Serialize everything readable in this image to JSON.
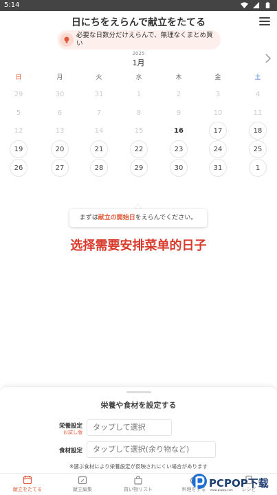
{
  "status": {
    "time": "5:14",
    "icons": [
      "wifi-icon",
      "signal-icon",
      "battery-icon"
    ]
  },
  "header": {
    "title": "日にちをえらんで献立をたてる",
    "menu_icon": "hamburger-menu-icon"
  },
  "tip": {
    "icon": "lightbulb-icon",
    "text": "必要な日数分だけえらんで、無理なくまとめ買い"
  },
  "calendar": {
    "year": "2025",
    "month": "1月",
    "weekdays": [
      "日",
      "月",
      "火",
      "水",
      "木",
      "金",
      "土"
    ],
    "days": [
      {
        "label": "29",
        "state": "disabled"
      },
      {
        "label": "30",
        "state": "disabled"
      },
      {
        "label": "31",
        "state": "disabled"
      },
      {
        "label": "1",
        "state": "disabled"
      },
      {
        "label": "2",
        "state": "disabled"
      },
      {
        "label": "3",
        "state": "disabled"
      },
      {
        "label": "4",
        "state": "disabled"
      },
      {
        "label": "5",
        "state": "disabled"
      },
      {
        "label": "6",
        "state": "disabled"
      },
      {
        "label": "7",
        "state": "disabled"
      },
      {
        "label": "8",
        "state": "disabled"
      },
      {
        "label": "9",
        "state": "disabled"
      },
      {
        "label": "10",
        "state": "disabled"
      },
      {
        "label": "11",
        "state": "disabled"
      },
      {
        "label": "12",
        "state": "disabled"
      },
      {
        "label": "13",
        "state": "disabled"
      },
      {
        "label": "14",
        "state": "disabled"
      },
      {
        "label": "15",
        "state": "disabled"
      },
      {
        "label": "16",
        "state": "today"
      },
      {
        "label": "17",
        "state": "active"
      },
      {
        "label": "18",
        "state": "active"
      },
      {
        "label": "19",
        "state": "active"
      },
      {
        "label": "20",
        "state": "active"
      },
      {
        "label": "21",
        "state": "active"
      },
      {
        "label": "22",
        "state": "active"
      },
      {
        "label": "23",
        "state": "active"
      },
      {
        "label": "24",
        "state": "active"
      },
      {
        "label": "25",
        "state": "active"
      },
      {
        "label": "26",
        "state": "active"
      },
      {
        "label": "27",
        "state": "active"
      },
      {
        "label": "28",
        "state": "active"
      },
      {
        "label": "29",
        "state": "active"
      },
      {
        "label": "30",
        "state": "active"
      },
      {
        "label": "31",
        "state": "active"
      },
      {
        "label": "1",
        "state": "active"
      }
    ]
  },
  "tooltip": {
    "prefix": "まずは",
    "highlight": "献立の開始日",
    "suffix": "をえらんでください。"
  },
  "caption": "选择需要安排菜单的日子",
  "sheet": {
    "title": "栄養や食材を設定する",
    "nutrition_label": "栄養設定",
    "nutrition_badge": "お試し版",
    "nutrition_placeholder": "タップして選択",
    "ingredient_label": "食材設定",
    "ingredient_placeholder": "タップして選択(余り物など)",
    "note": "※選ぶ食材により栄養設定が反映されにくい場合があります"
  },
  "nav": [
    {
      "label": "献立をたてる",
      "icon": "calendar-icon",
      "active": true
    },
    {
      "label": "献立編集",
      "icon": "edit-calendar-icon",
      "active": false
    },
    {
      "label": "買い物リスト",
      "icon": "shopping-bag-icon",
      "active": false
    },
    {
      "label": "料理をする",
      "icon": "cooking-icon",
      "active": false
    },
    {
      "label": "レシピ",
      "icon": "recipe-icon",
      "active": false
    }
  ],
  "watermark": {
    "text": "PCPOP下载",
    "sub": "www.pcpop.com"
  },
  "colors": {
    "accent": "#e05a3a",
    "saturday": "#2b6cd0",
    "caption": "#d83a2c"
  }
}
